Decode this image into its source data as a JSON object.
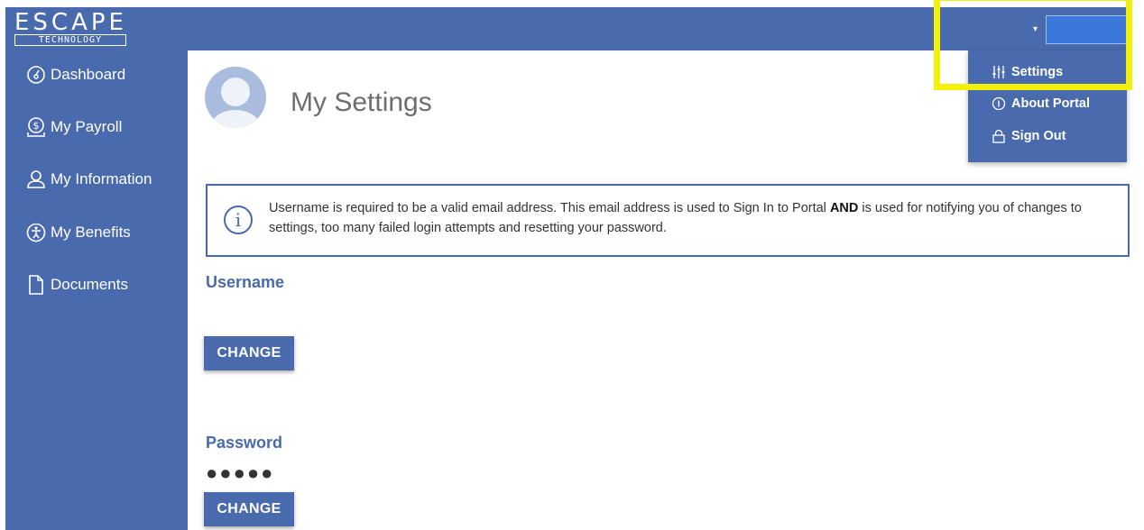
{
  "logo": {
    "main": "ESCAPE",
    "sub": "TECHNOLOGY"
  },
  "header": {
    "user_caret": "▾"
  },
  "sidebar": {
    "items": [
      {
        "label": "Dashboard",
        "icon": "gauge-icon"
      },
      {
        "label": "My Payroll",
        "icon": "payroll-icon"
      },
      {
        "label": "My Information",
        "icon": "user-icon"
      },
      {
        "label": "My Benefits",
        "icon": "accessibility-icon"
      },
      {
        "label": "Documents",
        "icon": "document-icon"
      }
    ]
  },
  "main": {
    "title": "My Settings",
    "info": {
      "text_before": "Username is required to be a valid email address. This email address is used to Sign In to Portal ",
      "text_bold": "AND",
      "text_after": " is used for notifying you of changes to settings, too many failed login attempts and resetting your password."
    },
    "username": {
      "label": "Username",
      "button": "CHANGE"
    },
    "password": {
      "label": "Password",
      "masked": "●●●●●",
      "button": "CHANGE"
    }
  },
  "dropdown": {
    "items": [
      {
        "label": "Settings",
        "icon": "sliders-icon"
      },
      {
        "label": "About Portal",
        "icon": "info-icon"
      },
      {
        "label": "Sign Out",
        "icon": "lock-icon"
      }
    ]
  },
  "colors": {
    "brand": "#4a6aae",
    "highlight": "#f4f00a",
    "user_box": "#3a78dc"
  }
}
